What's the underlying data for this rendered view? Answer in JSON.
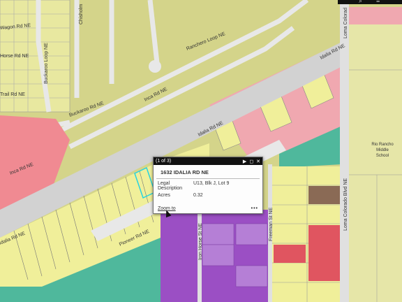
{
  "roads": {
    "wagon": "Wagon Rd NE",
    "chisholm": "Chisholm",
    "horse": "Horse Rd NE",
    "trail": "Trail Rd NE",
    "buckaroo_loop": "Buckaroo Loop NE",
    "ranchero_loop": "Ranchero Loop NE",
    "idalia_top": "Idalia Rd NE",
    "idalia_mid": "Idalia Rd NE",
    "inca_mid": "Inca Rd NE",
    "inca_left": "Inca Rd NE",
    "buckaroo_rd": "Buckaroo Rd NE",
    "idalia_left": "Idalia Rd NE",
    "pioneer": "Pioneer Rd NE",
    "iron_horse": "Iron Horse St NE",
    "freeman": "Freeman St NE",
    "loma_colorado": "Loma Colorado Blvd NE",
    "loma_col_top": "Loma Colorad",
    "school": [
      "Rio Rancho",
      "Middle",
      "School"
    ]
  },
  "popup": {
    "counter": "(1 of 3)",
    "address": "1632 IDALIA RD NE",
    "rows": [
      {
        "key": "Legal Description",
        "value": "U13, Blk J, Lot 9"
      },
      {
        "key": "Acres",
        "value": "0.32"
      }
    ],
    "zoom_label": "Zoom to",
    "more_label": "•••"
  },
  "colors": {
    "residential": "#d9d98c",
    "commercial": "#f0a0a8",
    "yellow_lot": "#f0ef9a",
    "purple": "#9b4fc4",
    "teal": "#4fb89c",
    "road": "#d8d8d8",
    "brown": "#8a6a55",
    "red": "#e05560"
  }
}
